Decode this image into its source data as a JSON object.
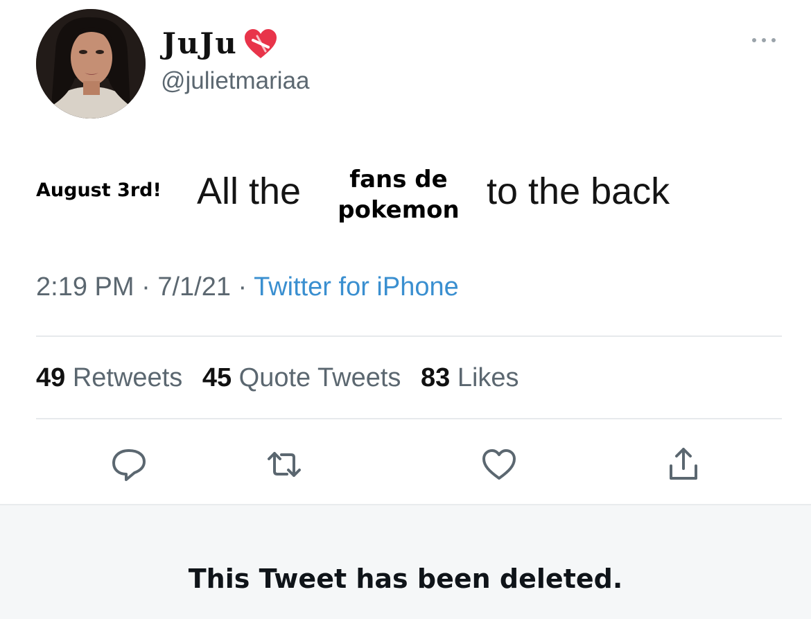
{
  "user": {
    "display_name": "JuJu",
    "name_emoji_icon": "mending-heart-icon",
    "handle": "@julietmariaa"
  },
  "tweet": {
    "overlay_prefix": "August 3rd!",
    "text_before": "All the",
    "overlay_middle_line1": "fans de",
    "overlay_middle_line2": "pokemon",
    "text_after": "to the back"
  },
  "meta": {
    "time": "2:19 PM",
    "date": "7/1/21",
    "separator": "·",
    "source": "Twitter for iPhone"
  },
  "stats": {
    "retweets_count": "49",
    "retweets_label": "Retweets",
    "quotes_count": "45",
    "quotes_label": "Quote Tweets",
    "likes_count": "83",
    "likes_label": "Likes"
  },
  "actions": [
    "reply-icon",
    "retweet-icon",
    "like-icon",
    "share-icon"
  ],
  "deleted_notice": "This Tweet has been deleted.",
  "colors": {
    "secondary_text": "#5b6770",
    "link": "#3a8fd0",
    "heart": "#e8344a",
    "banner_bg": "#f5f7f8"
  }
}
